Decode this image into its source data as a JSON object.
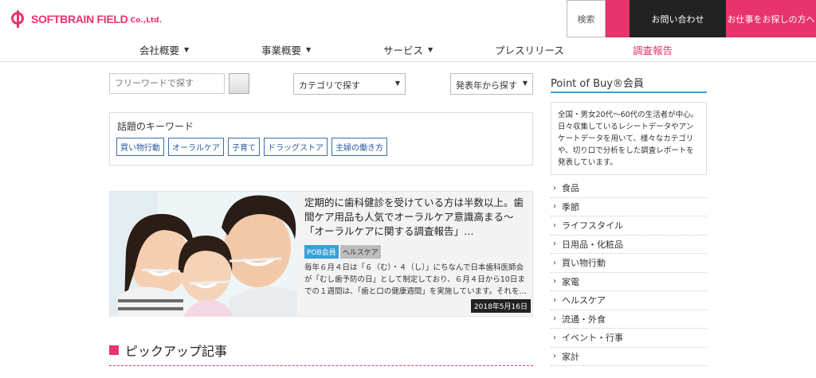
{
  "header": {
    "logo_text": "SOFTBRAIN FIELD",
    "logo_sub": "Co.,Ltd.",
    "search_label": "検索",
    "contact_label": "お問い合わせ",
    "jobs_label": "お仕事をお探しの方へ"
  },
  "nav": {
    "items": [
      {
        "label": "会社概要"
      },
      {
        "label": "事業概要"
      },
      {
        "label": "サービス"
      },
      {
        "label": "プレスリリース"
      },
      {
        "label": "調査報告"
      }
    ]
  },
  "search": {
    "placeholder": "フリーワードで探す",
    "category_select": "カテゴリで探す",
    "year_select": "発表年から探す"
  },
  "keywords": {
    "title": "話題のキーワード",
    "tags": [
      "買い物行動",
      "オーラルケア",
      "子育て",
      "ドラッグストア",
      "主婦の働き方"
    ]
  },
  "featured": {
    "title": "定期的に歯科健診を受けている方は半数以上。歯間ケア用品も人気でオーラルケア意識高まる～「オーラルケアに関する調査報告」…",
    "badges": [
      "POB会員",
      "ヘルスケア"
    ],
    "body": "毎年６月４日は「６（む）・４（し）」にちなんで日本歯科医師会が「むし歯予防の日」として制定しており、６月４日から10日までの１週間は、「歯と口の健康週間」を実施しています。それを…",
    "date": "2018年5月16日"
  },
  "pickup": {
    "title": "ピックアップ記事"
  },
  "sidebar": {
    "title": "Point of Buy®会員",
    "description": "全国・男女20代～60代の生活者が中心。日々収集しているレシートデータやアンケートデータを用いて、様々なカテゴリや、切り口で分析をした調査レポートを発表しています。",
    "categories": [
      "食品",
      "季節",
      "ライフスタイル",
      "日用品・化粧品",
      "買い物行動",
      "家電",
      "ヘルスケア",
      "流通・外食",
      "イベント・行事",
      "家計"
    ]
  }
}
